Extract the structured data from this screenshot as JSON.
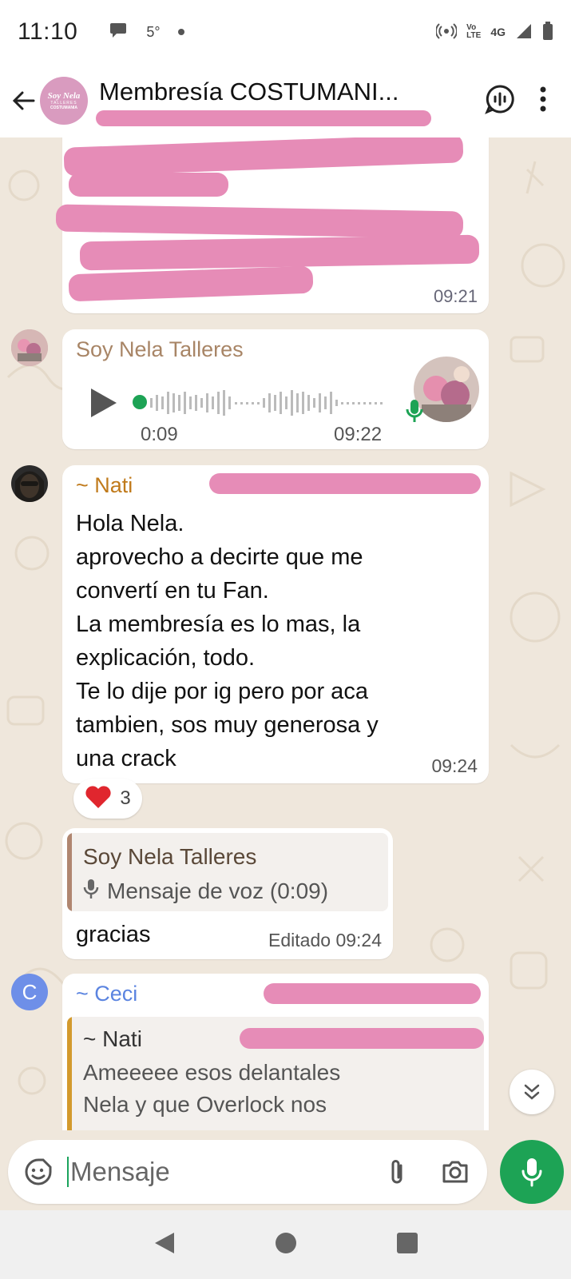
{
  "status_bar": {
    "time": "11:10",
    "temperature": "5°",
    "network": "4G",
    "volte": "Vo\nLTE"
  },
  "header": {
    "title": "Membresía COSTUMANI...",
    "avatar_line1": "Soy Nela",
    "avatar_line2": "TALLERES",
    "avatar_line3": "COSTUMANIA",
    "back_icon": "arrow-left-icon",
    "voice_chat_icon": "voice-chat-icon",
    "menu_icon": "more-vert-icon"
  },
  "messages": {
    "m1": {
      "time": "09:21"
    },
    "m2": {
      "sender": "Soy Nela Talleres",
      "duration": "0:09",
      "time": "09:22",
      "sender_color": "#a88566"
    },
    "m3": {
      "sender": "~ Nati",
      "sender_color": "#c07a1b",
      "lines": [
        "Hola Nela.",
        "aprovecho a decirte que me",
        "convertí en tu Fan.",
        "La membresía es lo mas, la",
        "explicación, todo.",
        "Te lo dije por ig pero por aca",
        "tambien, sos muy generosa y",
        "una crack"
      ],
      "time": "09:24",
      "reaction_emoji": "❤️",
      "reaction_count": "3"
    },
    "m4": {
      "quote_sender": "Soy Nela Talleres",
      "quote_text": "Mensaje de voz (0:09)",
      "text": "gracias",
      "time": "Editado 09:24"
    },
    "m5": {
      "avatar_letter": "C",
      "sender": "~ Ceci",
      "sender_color": "#5b84e0",
      "quote_sender": "~ Nati",
      "quote_lines": [
        "Ameeeee esos delantales",
        "Nela y que Overlock nos"
      ]
    }
  },
  "input": {
    "placeholder": "Mensaje"
  },
  "colors": {
    "accent": "#1da355",
    "chat_bg": "#efe7dc",
    "redaction": "#e68cb7"
  }
}
